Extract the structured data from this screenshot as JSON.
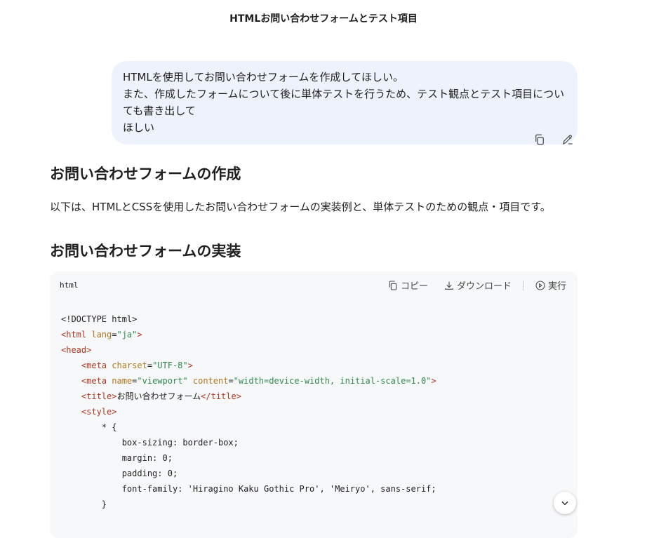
{
  "header": {
    "title": "HTMLお問い合わせフォームとテスト項目"
  },
  "user_message": {
    "lines": [
      "HTMLを使用してお問い合わせフォームを作成してほしい。",
      "また、作成したフォームについて後に単体テストを行うため、テスト観点とテスト項目についても書き出して",
      "ほしい"
    ]
  },
  "message_actions": {
    "copy_icon": "copy-icon",
    "edit_icon": "pencil-icon"
  },
  "response": {
    "heading1": "お問い合わせフォームの作成",
    "intro": "以下は、HTMLとCSSを使用したお問い合わせフォームの実装例と、単体テストのための観点・項目です。",
    "heading2": "お問い合わせフォームの実装"
  },
  "code_block": {
    "language": "html",
    "copy_label": "コピー",
    "download_label": "ダウンロード",
    "run_label": "実行",
    "lines": [
      [
        {
          "t": "<!DOCTYPE html>",
          "c": "plain"
        }
      ],
      [
        {
          "t": "<html",
          "c": "tag"
        },
        {
          "t": " lang",
          "c": "attr"
        },
        {
          "t": "=",
          "c": "plain"
        },
        {
          "t": "\"ja\"",
          "c": "str"
        },
        {
          "t": ">",
          "c": "tag"
        }
      ],
      [
        {
          "t": "<head>",
          "c": "tag"
        }
      ],
      [
        {
          "t": "    <meta",
          "c": "tag"
        },
        {
          "t": " charset",
          "c": "attr"
        },
        {
          "t": "=",
          "c": "plain"
        },
        {
          "t": "\"UTF-8\"",
          "c": "str"
        },
        {
          "t": ">",
          "c": "tag"
        }
      ],
      [
        {
          "t": "    <meta",
          "c": "tag"
        },
        {
          "t": " name",
          "c": "attr"
        },
        {
          "t": "=",
          "c": "plain"
        },
        {
          "t": "\"viewport\"",
          "c": "str"
        },
        {
          "t": " content",
          "c": "attr"
        },
        {
          "t": "=",
          "c": "plain"
        },
        {
          "t": "\"width=device-width, initial-scale=1.0\"",
          "c": "str"
        },
        {
          "t": ">",
          "c": "tag"
        }
      ],
      [
        {
          "t": "    <title>",
          "c": "tag"
        },
        {
          "t": "お問い合わせフォーム",
          "c": "plain"
        },
        {
          "t": "</title>",
          "c": "tag"
        }
      ],
      [
        {
          "t": "    <style>",
          "c": "tag"
        }
      ],
      [
        {
          "t": "        * {",
          "c": "plain"
        }
      ],
      [
        {
          "t": "            box-sizing: border-box;",
          "c": "plain"
        }
      ],
      [
        {
          "t": "            margin: 0;",
          "c": "plain"
        }
      ],
      [
        {
          "t": "            padding: 0;",
          "c": "plain"
        }
      ],
      [
        {
          "t": "            font-family: 'Hiragino Kaku Gothic Pro', 'Meiryo', sans-serif;",
          "c": "plain"
        }
      ],
      [
        {
          "t": "        }",
          "c": "plain"
        }
      ]
    ]
  },
  "scroll_button": {
    "icon": "chevron-down-icon"
  }
}
